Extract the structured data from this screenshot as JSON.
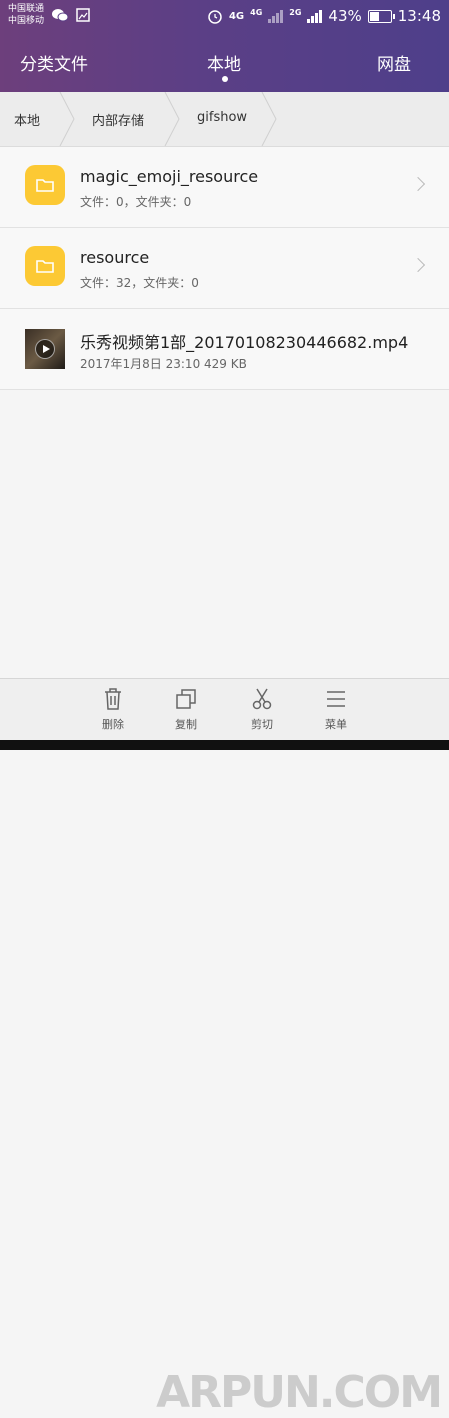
{
  "status_bar": {
    "carrier_1": "中国联通",
    "carrier_2": "中国移动",
    "net_4g": "4G",
    "net_4g_small": "4G",
    "net_2g": "2G",
    "battery": "43%",
    "time": "13:48",
    "icons": [
      "wechat-icon",
      "image-icon",
      "alarm-icon"
    ]
  },
  "tabs": [
    {
      "label": "分类文件",
      "active": false
    },
    {
      "label": "本地",
      "active": true
    },
    {
      "label": "网盘",
      "active": false
    }
  ],
  "breadcrumb": [
    "本地",
    "内部存储",
    "gifshow"
  ],
  "files": [
    {
      "type": "folder",
      "name": "magic_emoji_resource",
      "meta": "文件：0，文件夹：0"
    },
    {
      "type": "folder",
      "name": "resource",
      "meta": "文件：32，文件夹：0"
    },
    {
      "type": "video",
      "name": "乐秀视频第1部_20170108230446682.mp4",
      "meta": "2017年1月8日 23:10 429 KB"
    }
  ],
  "toolbar": [
    {
      "label": "删除",
      "icon": "trash-icon"
    },
    {
      "label": "复制",
      "icon": "copy-icon"
    },
    {
      "label": "剪切",
      "icon": "scissors-icon"
    },
    {
      "label": "菜单",
      "icon": "menu-icon"
    }
  ],
  "watermark": "ARPUN.COM",
  "colors": {
    "header_start": "#6d3f7c",
    "header_end": "#4e3f8a",
    "folder": "#fcc934"
  }
}
